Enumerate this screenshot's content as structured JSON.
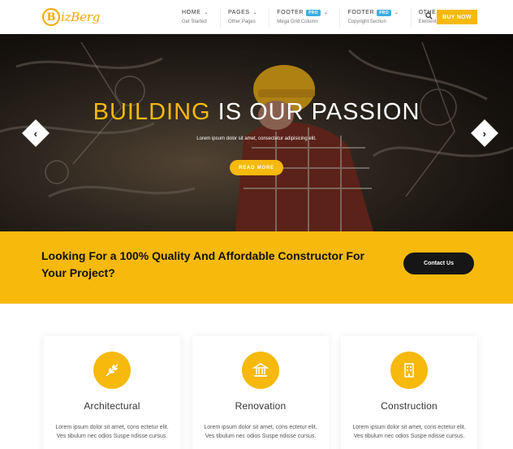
{
  "brand": {
    "logo_letter": "B",
    "logo_text": "izBerg"
  },
  "nav": [
    {
      "label": "HOME",
      "sub": "Get Started",
      "pro": ""
    },
    {
      "label": "PAGES",
      "sub": "Other Pages",
      "pro": ""
    },
    {
      "label": "FOOTER",
      "sub": "Mega Grid Column",
      "pro": "PRO"
    },
    {
      "label": "FOOTER",
      "sub": "Copyright Section",
      "pro": "PRO"
    },
    {
      "label": "OTHERS",
      "sub": "Elements",
      "pro": ""
    }
  ],
  "header": {
    "buy_label": "BUY NOW",
    "search_icon": "search-icon"
  },
  "hero": {
    "title_accent": "BUILDING",
    "title_rest": " IS OUR PASSION",
    "subtitle": "Lorem ipsum dolor sit amet, consectetur adipisicing elit.",
    "button": "READ MORE",
    "prev_glyph": "‹",
    "next_glyph": "›"
  },
  "cta": {
    "text": "Looking For a 100% Quality And Affordable Constructor For Your Project?",
    "button": "Contact Us"
  },
  "services": [
    {
      "title": "Architectural",
      "desc": "Lorem ipsum dolor sit amet, cons ectetur elit. Ves tibulum nec odios Suspe ndisse cursus.",
      "icon": "leaf-icon"
    },
    {
      "title": "Renovation",
      "desc": "Lorem ipsum dolor sit amet, cons ectetur elit. Ves tibulum nec odios Suspe ndisse cursus.",
      "icon": "bank-icon"
    },
    {
      "title": "Construction",
      "desc": "Lorem ipsum dolor sit amet, cons ectetur elit. Ves tibulum nec odios Suspe ndisse cursus.",
      "icon": "building-icon"
    }
  ],
  "colors": {
    "accent": "#f6b90c",
    "dark": "#161616",
    "pro_badge": "#3aaee0"
  }
}
